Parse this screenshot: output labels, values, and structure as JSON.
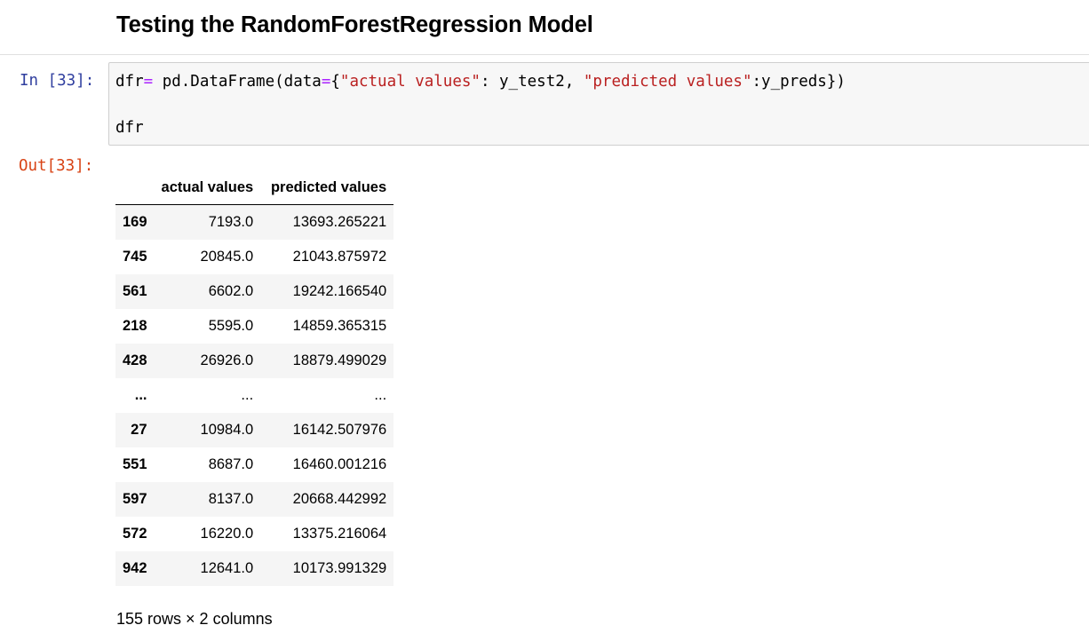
{
  "markdown": {
    "heading": "Testing the RandomForestRegression Model"
  },
  "input_cell": {
    "prompt": "In [33]:",
    "code_lines": [
      {
        "tokens": [
          {
            "text": "dfr",
            "kind": "plain"
          },
          {
            "text": "=",
            "kind": "op"
          },
          {
            "text": " pd.DataFrame(data",
            "kind": "plain"
          },
          {
            "text": "=",
            "kind": "op"
          },
          {
            "text": "{",
            "kind": "plain"
          },
          {
            "text": "\"actual values\"",
            "kind": "str"
          },
          {
            "text": ": y_test2, ",
            "kind": "plain"
          },
          {
            "text": "\"predicted values\"",
            "kind": "str"
          },
          {
            "text": ":y_preds})",
            "kind": "plain"
          }
        ]
      },
      {
        "tokens": [
          {
            "text": "dfr",
            "kind": "plain"
          }
        ]
      }
    ]
  },
  "output_cell": {
    "prompt": "Out[33]:",
    "table": {
      "index_header": "",
      "columns": [
        "actual values",
        "predicted values"
      ],
      "rows": [
        {
          "index": "169",
          "actual": "7193.0",
          "predicted": "13693.265221"
        },
        {
          "index": "745",
          "actual": "20845.0",
          "predicted": "21043.875972"
        },
        {
          "index": "561",
          "actual": "6602.0",
          "predicted": "19242.166540"
        },
        {
          "index": "218",
          "actual": "5595.0",
          "predicted": "14859.365315"
        },
        {
          "index": "428",
          "actual": "26926.0",
          "predicted": "18879.499029"
        },
        {
          "index": "...",
          "actual": "...",
          "predicted": "..."
        },
        {
          "index": "27",
          "actual": "10984.0",
          "predicted": "16142.507976"
        },
        {
          "index": "551",
          "actual": "8687.0",
          "predicted": "16460.001216"
        },
        {
          "index": "597",
          "actual": "8137.0",
          "predicted": "20668.442992"
        },
        {
          "index": "572",
          "actual": "16220.0",
          "predicted": "13375.216064"
        },
        {
          "index": "942",
          "actual": "12641.0",
          "predicted": "10173.991329"
        }
      ]
    },
    "dimensions": "155 rows × 2 columns"
  },
  "colors": {
    "in_prompt": "#303f9f",
    "out_prompt": "#d84315",
    "code_background": "#f7f7f7",
    "code_border": "#cfcfcf",
    "keyword_operator": "#aa22ff",
    "string_literal": "#ba2121",
    "row_stripe": "#f5f5f5"
  }
}
